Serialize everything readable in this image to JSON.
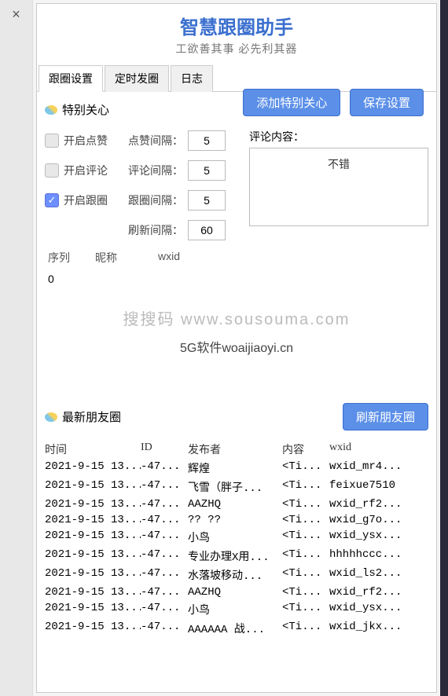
{
  "close_glyph": "×",
  "header": {
    "title": "智慧跟圈助手",
    "subtitle": "工欲善其事 必先利其器"
  },
  "tabs": [
    "跟圈设置",
    "定时发圈",
    "日志"
  ],
  "active_tab": 0,
  "section1_title": "特别关心",
  "btn_add_special": "添加特别关心",
  "btn_save": "保存设置",
  "opts": {
    "like": {
      "label": "开启点赞",
      "checked": false
    },
    "comment": {
      "label": "开启评论",
      "checked": false
    },
    "follow": {
      "label": "开启跟圈",
      "checked": true
    }
  },
  "intervals": {
    "like": {
      "label": "点赞间隔：",
      "value": "5"
    },
    "comment": {
      "label": "评论间隔：",
      "value": "5"
    },
    "follow": {
      "label": "跟圈间隔：",
      "value": "5"
    },
    "refresh": {
      "label": "刷新间隔：",
      "value": "60"
    }
  },
  "comment_label": "评论内容：",
  "comment_content": "不错",
  "table1": {
    "headers": {
      "seq": "序列",
      "nick": "昵称",
      "wxid": "wxid"
    },
    "rows": [
      {
        "seq": "0",
        "nick": "",
        "wxid": ""
      }
    ]
  },
  "watermark1": "搜搜码 www.sousouma.com",
  "watermark2": "5G软件woaijiaoyi.cn",
  "section2_title": "最新朋友圈",
  "btn_refresh_moments": "刷新朋友圈",
  "table2": {
    "headers": {
      "time": "时间",
      "id": "ID",
      "pub": "发布者",
      "cont": "内容",
      "wxid": "wxid"
    },
    "rows": [
      {
        "time": "2021-9-15 13...",
        "id": "-47...",
        "pub": "辉煌",
        "cont": "<Ti...",
        "wxid": "wxid_mr4..."
      },
      {
        "time": "2021-9-15 13...",
        "id": "-47...",
        "pub": "飞雪（胖子...",
        "cont": "<Ti...",
        "wxid": "feixue7510"
      },
      {
        "time": "2021-9-15 13...",
        "id": "-47...",
        "pub": "AAZHQ",
        "cont": "<Ti...",
        "wxid": "wxid_rf2..."
      },
      {
        "time": "2021-9-15 13...",
        "id": "-47...",
        "pub": "?? ??",
        "cont": "<Ti...",
        "wxid": "wxid_g7o..."
      },
      {
        "time": "2021-9-15 13...",
        "id": "-47...",
        "pub": "小鸟",
        "cont": "<Ti...",
        "wxid": "wxid_ysx..."
      },
      {
        "time": "2021-9-15 13...",
        "id": "-47...",
        "pub": "专业办理X用...",
        "cont": "<Ti...",
        "wxid": "hhhhhccc..."
      },
      {
        "time": "2021-9-15 13...",
        "id": "-47...",
        "pub": "水落坡移动...",
        "cont": "<Ti...",
        "wxid": "wxid_ls2..."
      },
      {
        "time": "2021-9-15 13...",
        "id": "-47...",
        "pub": "AAZHQ",
        "cont": "<Ti...",
        "wxid": "wxid_rf2..."
      },
      {
        "time": "2021-9-15 13...",
        "id": "-47...",
        "pub": "小鸟",
        "cont": "<Ti...",
        "wxid": "wxid_ysx..."
      },
      {
        "time": "2021-9-15 13...",
        "id": "-47...",
        "pub": "AAAAAA  战...",
        "cont": "<Ti...",
        "wxid": "wxid_jkx..."
      }
    ]
  }
}
